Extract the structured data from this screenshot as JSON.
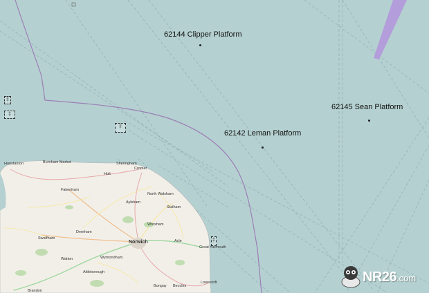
{
  "map": {
    "sea_color": "#b5d0d0",
    "land_color": "#f2efe9",
    "border_color": "#9b7fb8",
    "restricted_area_color": "#b39ddb",
    "platforms": [
      {
        "label": "62144 Clipper Platform"
      },
      {
        "label": "62142 Leman Platform"
      },
      {
        "label": "62145 Sean Platform"
      }
    ],
    "towns": [
      "Hunstanton",
      "Burnham Market",
      "Sheringham",
      "Cromer",
      "Holt",
      "Fakenham",
      "North Walsham",
      "Aylsham",
      "Stalham",
      "Dereham",
      "Wroxham",
      "Swaffham",
      "Norwich",
      "Acle",
      "Great Yarmouth",
      "Watton",
      "Wymondham",
      "Attleborough",
      "Bungay",
      "Beccles",
      "Lowestoft",
      "Brandon"
    ],
    "buoy_icons": [
      "buoy-icon",
      "buoy-icon",
      "buoy-icon",
      "buoy-icon"
    ]
  },
  "watermark": {
    "brand": "NR26",
    "suffix": ".com",
    "icon": "mascot-icon"
  }
}
